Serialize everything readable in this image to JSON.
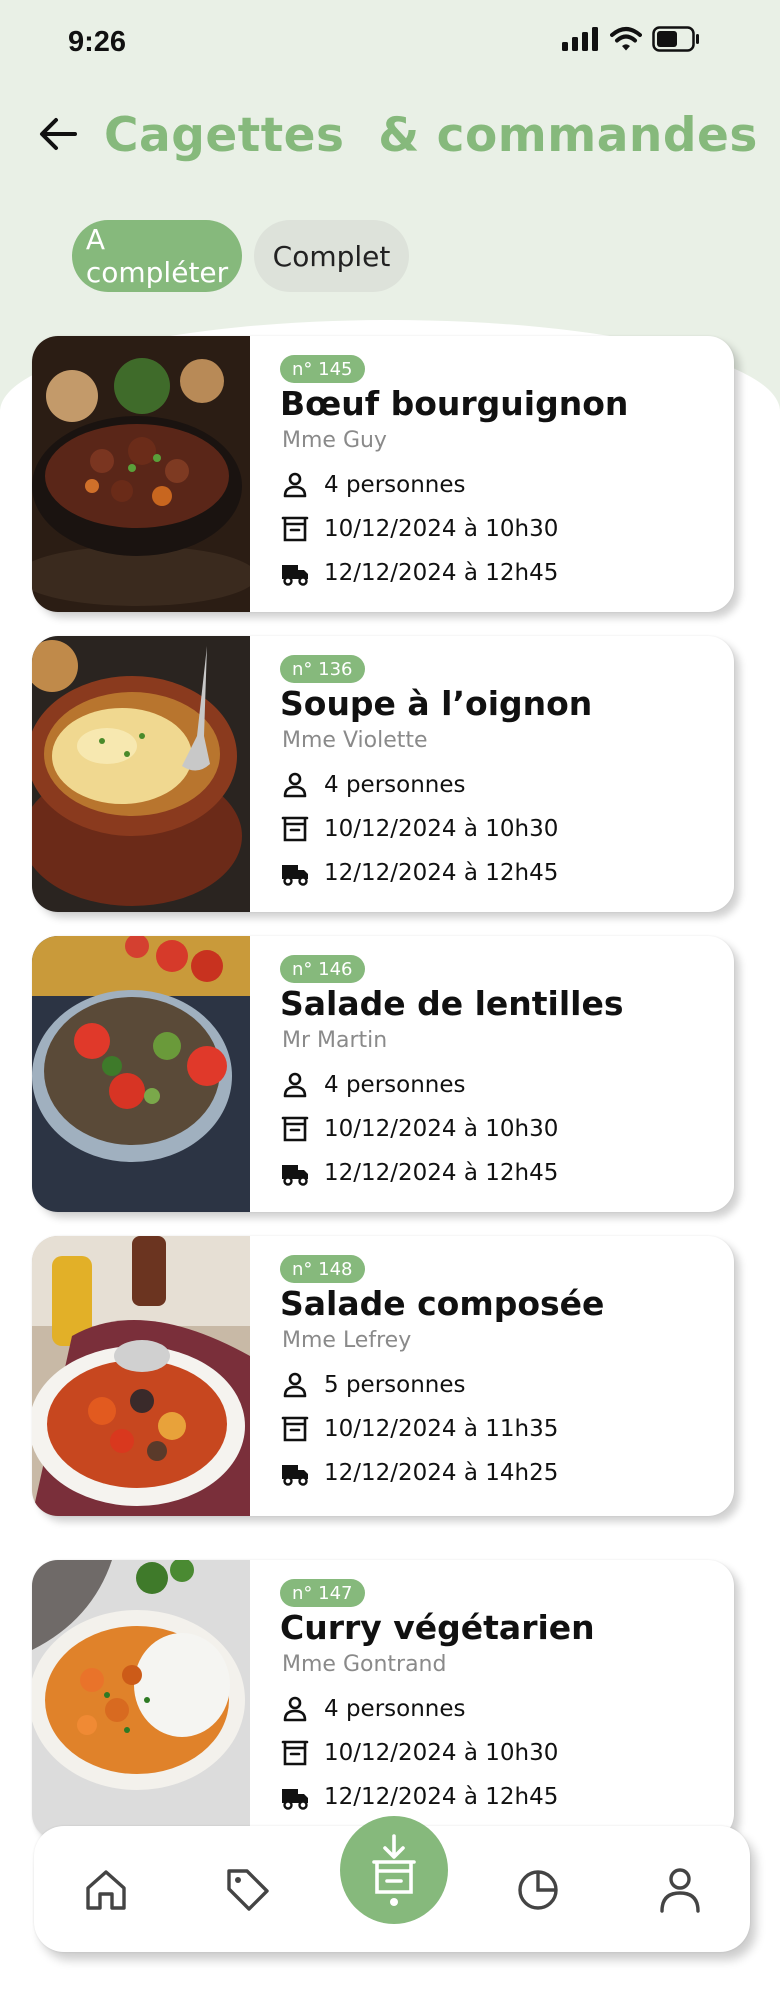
{
  "status_bar": {
    "time": "9:26"
  },
  "header": {
    "title": "Cagettes  & commandes"
  },
  "filters": {
    "active": "A compléter",
    "inactive": "Complet"
  },
  "orders": [
    {
      "number": "n° 145",
      "dish": "Bœuf bourguignon",
      "client": "Mme Guy",
      "people": "4 personnes",
      "prepared": "10/12/2024 à 10h30",
      "delivery": "12/12/2024 à 12h45",
      "image": "beef-stew-pot"
    },
    {
      "number": "n° 136",
      "dish": "Soupe à l’oignon",
      "client": "Mme Violette",
      "people": "4 personnes",
      "prepared": "10/12/2024 à 10h30",
      "delivery": "12/12/2024 à 12h45",
      "image": "onion-soup-bowl"
    },
    {
      "number": "n° 146",
      "dish": "Salade de lentilles",
      "client": "Mr Martin",
      "people": "4 personnes",
      "prepared": "10/12/2024 à 10h30",
      "delivery": "12/12/2024 à 12h45",
      "image": "lentil-salad-bowl"
    },
    {
      "number": "n° 148",
      "dish": "Salade composée",
      "client": "Mme Lefrey",
      "people": "5 personnes",
      "prepared": "10/12/2024 à 11h35",
      "delivery": "12/12/2024 à 14h25",
      "image": "mixed-salad-bowl"
    },
    {
      "number": "n° 147",
      "dish": "Curry végétarien",
      "client": "Mme Gontrand",
      "people": "4 personnes",
      "prepared": "10/12/2024 à 10h30",
      "delivery": "12/12/2024 à 12h45",
      "image": "curry-rice-bowl"
    }
  ],
  "nav": {
    "items": [
      "home-icon",
      "tag-icon",
      "crate-download-icon",
      "pie-chart-icon",
      "user-icon"
    ],
    "active": "crate-download-icon"
  },
  "colors": {
    "accent": "#86b97c",
    "header_bg": "#e9f0e6",
    "chip_inactive": "#dde2da"
  }
}
